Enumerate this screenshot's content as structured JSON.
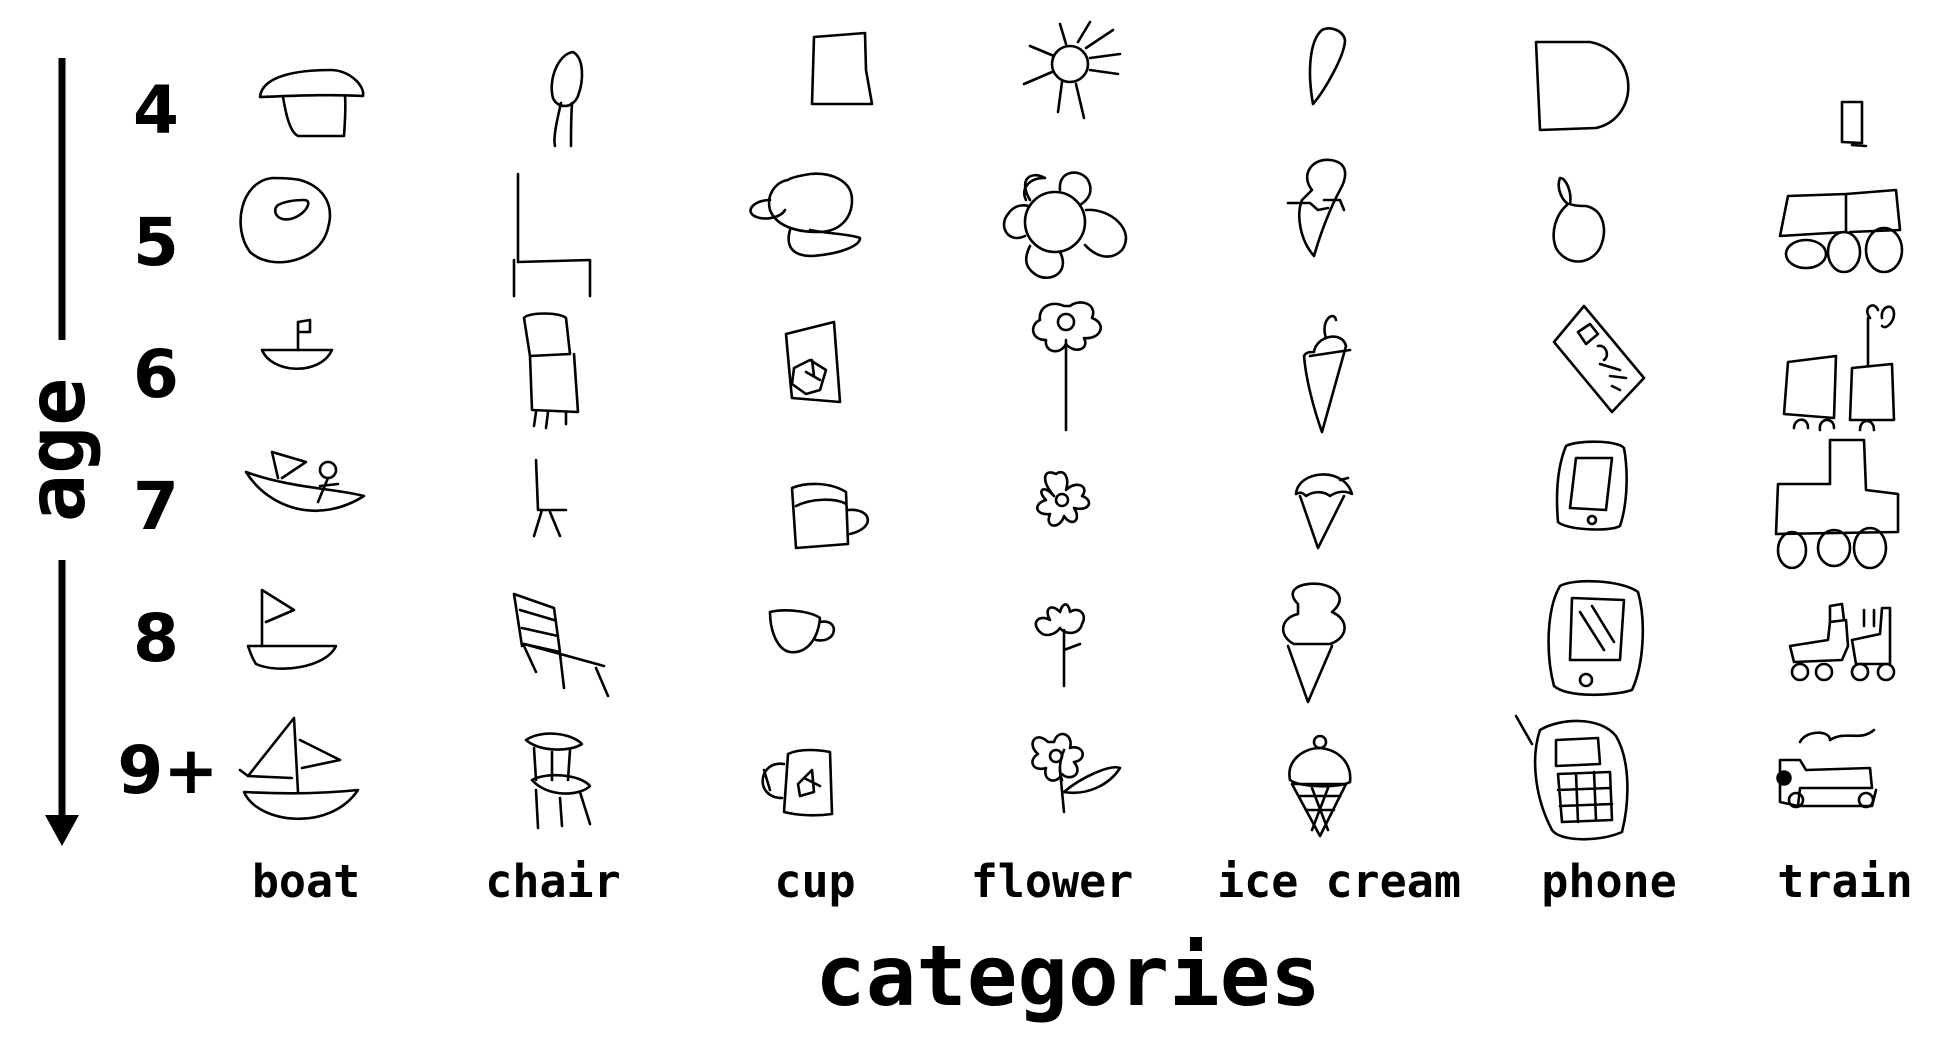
{
  "y_axis_label": "age",
  "x_axis_label": "categories",
  "ages": [
    "4",
    "5",
    "6",
    "7",
    "8",
    "9+"
  ],
  "categories": [
    "boat",
    "chair",
    "cup",
    "flower",
    "ice cream",
    "phone",
    "train"
  ]
}
